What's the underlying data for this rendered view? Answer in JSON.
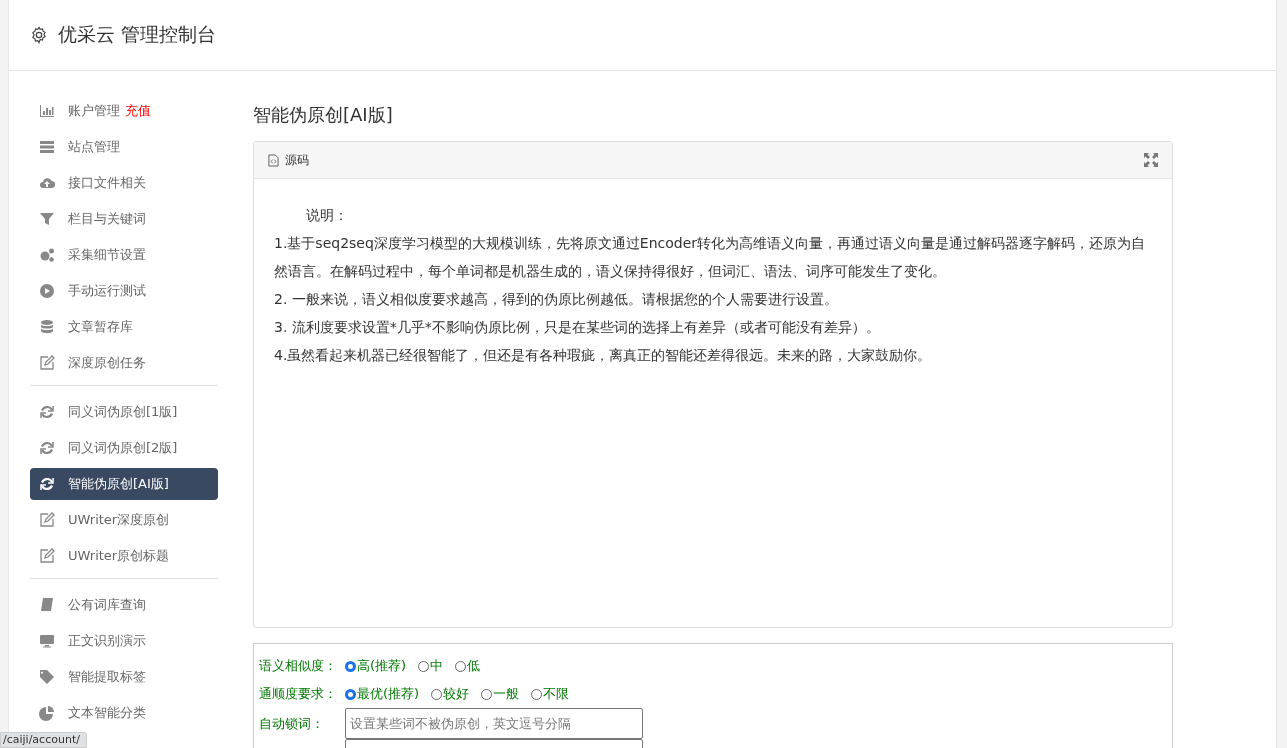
{
  "header": {
    "title": "优采云 管理控制台"
  },
  "sidebar": {
    "groups": [
      [
        {
          "label": "账户管理",
          "badge": "充值",
          "selected": false
        },
        {
          "label": "站点管理",
          "selected": false
        },
        {
          "label": "接口文件相关",
          "selected": false
        },
        {
          "label": "栏目与关键词",
          "selected": false
        },
        {
          "label": "采集细节设置",
          "selected": false
        },
        {
          "label": "手动运行测试",
          "selected": false
        },
        {
          "label": "文章暂存库",
          "selected": false
        },
        {
          "label": "深度原创任务",
          "selected": false
        }
      ],
      [
        {
          "label": "同义词伪原创[1版]",
          "selected": false
        },
        {
          "label": "同义词伪原创[2版]",
          "selected": false
        },
        {
          "label": "智能伪原创[AI版]",
          "selected": true
        },
        {
          "label": "UWriter深度原创",
          "selected": false
        },
        {
          "label": "UWriter原创标题",
          "selected": false
        }
      ],
      [
        {
          "label": "公有词库查询",
          "selected": false
        },
        {
          "label": "正文识别演示",
          "selected": false
        },
        {
          "label": "智能提取标签",
          "selected": false
        },
        {
          "label": "文本智能分类",
          "selected": false
        }
      ]
    ]
  },
  "main": {
    "title": "智能伪原创[AI版]",
    "editor": {
      "toolbar_label": "源码",
      "lines": [
        "说明：",
        "1.基于seq2seq深度学习模型的大规模训练，先将原文通过Encoder转化为高维语义向量，再通过语义向量是通过解码器逐字解码，还原为自然语言。在解码过程中，每个单词都是机器生成的，语义保持得很好，但词汇、语法、词序可能发生了变化。",
        "2. 一般来说，语义相似度要求越高，得到的伪原比例越低。请根据您的个人需要进行设置。",
        "3. 流利度要求设置*几乎*不影响伪原比例，只是在某些词的选择上有差异（或者可能没有差异）。",
        "4.虽然看起来机器已经很智能了，但还是有各种瑕疵，离真正的智能还差得很远。未来的路，大家鼓励你。"
      ]
    },
    "form": {
      "rows": [
        {
          "kind": "radio",
          "label": "语义相似度：",
          "options": [
            {
              "label": "高(推荐)",
              "selected": true
            },
            {
              "label": "中",
              "selected": false
            },
            {
              "label": "低",
              "selected": false
            }
          ]
        },
        {
          "kind": "radio",
          "label": "通顺度要求：",
          "options": [
            {
              "label": "最优(推荐)",
              "selected": true
            },
            {
              "label": "较好",
              "selected": false
            },
            {
              "label": "一般",
              "selected": false
            },
            {
              "label": "不限",
              "selected": false
            }
          ]
        },
        {
          "kind": "text",
          "label": "自动锁词：",
          "placeholder": "设置某些词不被伪原创，英文逗号分隔"
        },
        {
          "kind": "text"
        }
      ]
    }
  },
  "status_url": "/caiji/account/"
}
